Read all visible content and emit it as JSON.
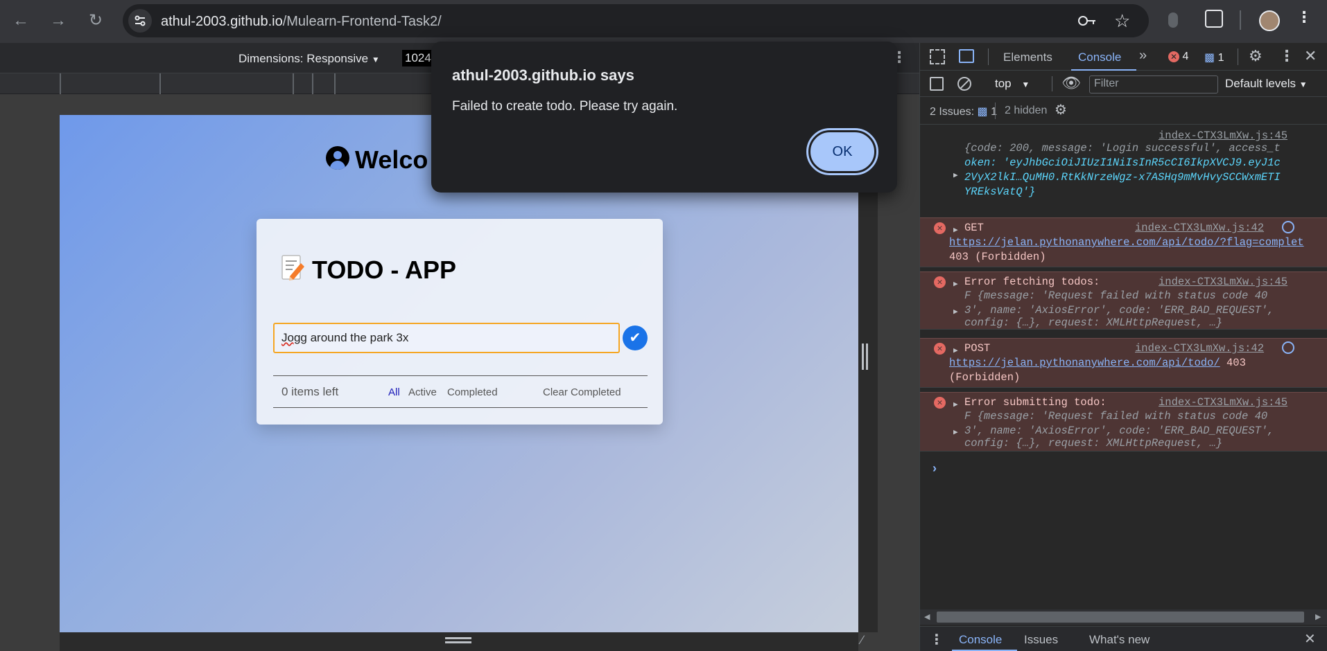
{
  "browser": {
    "url_host": "athul-2003.github.io",
    "url_path": "/Mulearn-Frontend-Task2/"
  },
  "device_toolbar": {
    "dimensions_label": "Dimensions: Responsive",
    "width_value": "1024"
  },
  "page": {
    "welcome_text": "Welco",
    "app_icon": "memo-icon",
    "app_title": "TODO - APP",
    "todo_first_word": "Jogg",
    "todo_rest": " around the park 3x",
    "items_left": "0 items left",
    "filters": [
      "All",
      "Active",
      "Completed"
    ],
    "clear_completed": "Clear Completed"
  },
  "alert": {
    "title": "athul-2003.github.io says",
    "message": "Failed to create todo. Please try again.",
    "ok_label": "OK"
  },
  "devtools": {
    "tabs": [
      "Elements",
      "Console"
    ],
    "active_tab": "Console",
    "error_count": "4",
    "message_count": "1",
    "context": "top",
    "filter_placeholder": "Filter",
    "levels": "Default levels",
    "issues_label": "2 Issues:",
    "issues_count": "1",
    "hidden_label": "2 hidden",
    "logs": [
      {
        "source": "index-CTX3LmXw.js:45",
        "line1": "{code: 200, message: 'Login successful', access_t",
        "line2": "oken: 'eyJhbGciOiJIUzI1NiIsInR5cCI6IkpXVCJ9.eyJ1c",
        "line3": "2VyX2lkI…QuMH0.RtKkNrzeWgz-x7ASHq9mMvHvySCCWxmETI",
        "line4": "YREksVatQ'}"
      },
      {
        "source": "index-CTX3LmXw.js:42",
        "method": "GET",
        "url": "https://jelan.pythonanywhere.com/api/todo/?flag=complet",
        "status": "403 (Forbidden)"
      },
      {
        "source": "index-CTX3LmXw.js:45",
        "title": "Error fetching todos:",
        "line1": "F {message: 'Request failed with status code 40",
        "line2": "3', name: 'AxiosError', code: 'ERR_BAD_REQUEST',",
        "line3": "config: {…}, request: XMLHttpRequest, …}"
      },
      {
        "source": "index-CTX3LmXw.js:42",
        "method": "POST",
        "url": "https://jelan.pythonanywhere.com/api/todo/",
        "status_inline": "403",
        "status": "(Forbidden)"
      },
      {
        "source": "index-CTX3LmXw.js:45",
        "title": "Error submitting todo:",
        "line1": "F {message: 'Request failed with status code 40",
        "line2": "3', name: 'AxiosError', code: 'ERR_BAD_REQUEST',",
        "line3": "config: {…}, request: XMLHttpRequest, …}"
      }
    ],
    "drawer_tabs": [
      "Console",
      "Issues",
      "What's new"
    ]
  }
}
